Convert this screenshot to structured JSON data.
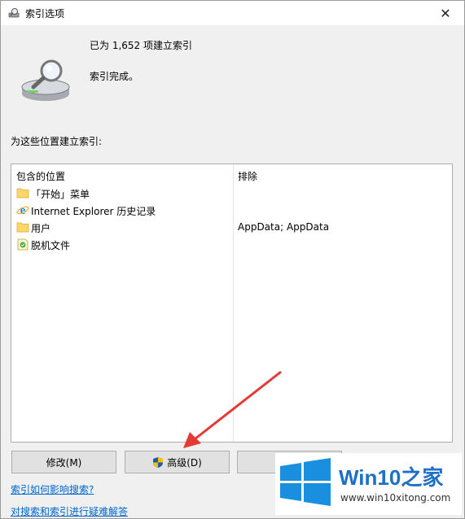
{
  "window": {
    "title": "索引选项",
    "close_glyph": "✕"
  },
  "status": {
    "count_line": "已为 1,652 项建立索引",
    "state_line": "索引完成。"
  },
  "section_label": "为这些位置建立索引:",
  "table": {
    "columns": [
      "包含的位置",
      "排除"
    ],
    "rows": [
      {
        "name": "「开始」菜单",
        "exclude": "",
        "icon": "folder-icon"
      },
      {
        "name": "Internet Explorer 历史记录",
        "exclude": "",
        "icon": "ie-icon"
      },
      {
        "name": "用户",
        "exclude": "AppData; AppData",
        "icon": "folder-icon"
      },
      {
        "name": "脱机文件",
        "exclude": "",
        "icon": "offline-files-icon"
      }
    ]
  },
  "buttons": {
    "modify": "修改(M)",
    "advanced": "高级(D)"
  },
  "links": {
    "how_affects": "索引如何影响搜索?",
    "troubleshoot": "对搜索和索引进行疑难解答"
  },
  "watermark": {
    "brand_a": "Win10",
    "brand_b": "之家",
    "url": "www.win10xitong.com"
  },
  "colors": {
    "link": "#0066cc",
    "brand_blue": "#1e6fc8",
    "annotation_arrow": "#e53935"
  }
}
